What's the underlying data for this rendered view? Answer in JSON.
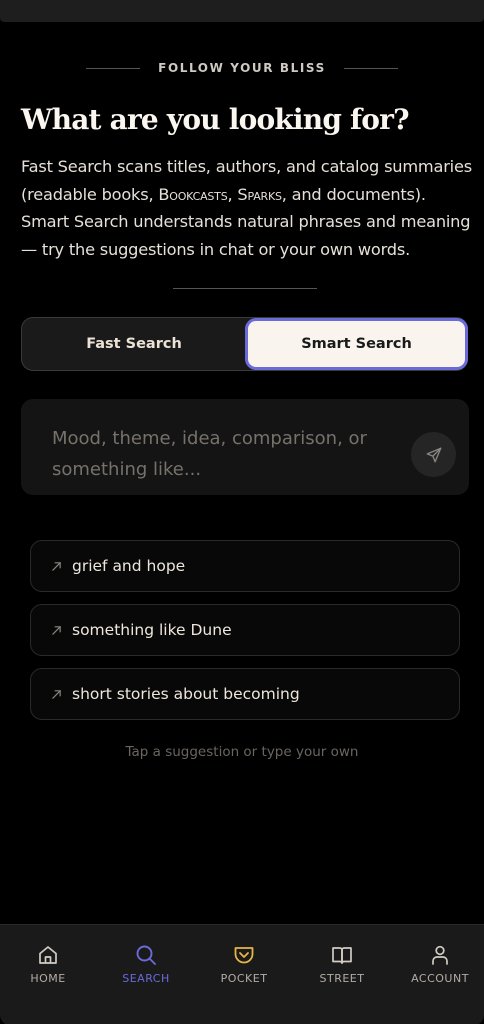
{
  "header": {
    "eyebrow": "FOLLOW YOUR BLISS",
    "title": "What are you looking for?",
    "description": {
      "part1": "Fast Search scans titles, authors, and catalog summaries (readable books, ",
      "bookcasts": "Bookcasts",
      "comma": ", ",
      "sparks": "Sparks",
      "part2": ", and documents). Smart Search understands natural phrases and meaning — try the suggestions in chat or your own words."
    }
  },
  "mode_toggle": {
    "fast_label": "Fast Search",
    "smart_label": "Smart Search",
    "selected": "Smart Search"
  },
  "search": {
    "placeholder": "Mood, theme, idea, comparison, or something like...",
    "send_icon": "send-icon"
  },
  "suggestions": [
    {
      "label": "grief and hope",
      "icon": "arrow-up-right-icon"
    },
    {
      "label": "something like Dune",
      "icon": "arrow-up-right-icon"
    },
    {
      "label": "short stories about becoming",
      "icon": "arrow-up-right-icon"
    }
  ],
  "hint": "Tap a suggestion or type your own",
  "nav": {
    "items": [
      {
        "label": "HOME",
        "icon": "home-icon"
      },
      {
        "label": "SEARCH",
        "icon": "search-icon",
        "active": true
      },
      {
        "label": "POCKET",
        "icon": "pocket-icon"
      },
      {
        "label": "STREET",
        "icon": "book-icon"
      },
      {
        "label": "ACCOUNT",
        "icon": "user-icon"
      }
    ]
  },
  "colors": {
    "background": "#000000",
    "accent": "#6a6ad8",
    "pocket_accent": "#e8b547",
    "selected_tab_bg": "#faf4ee"
  }
}
